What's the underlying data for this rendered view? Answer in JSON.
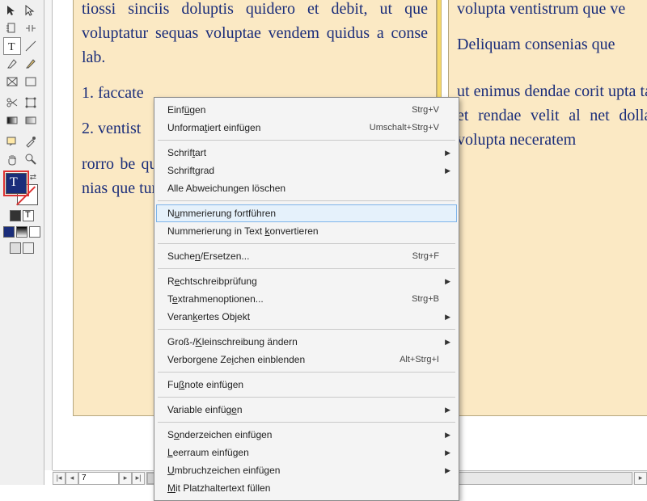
{
  "document": {
    "left_page": {
      "p1": "tiossi sinciis doluptis quidero et debit, ut que voluptatur sequas voluptae vendem quidus a conse lab.",
      "num1_no": "1.",
      "num1_text": "faccate",
      "num2_no": "2.",
      "num2_text": "ventist",
      "p2": "rorro be quam n les is m et lit, se everum ventistru nias que tum iun ea as ap"
    },
    "right_page": {
      "p1": "volupta ventistrum que ve",
      "p2": "Deliquam consenias que ",
      "p3": "ut enimus dendae corit upta tatium qui aliatio i orrum et rendae velit al net dollab is identio nec ndia volupta neceratem "
    }
  },
  "page_indicator": "7",
  "context_menu": {
    "items": [
      {
        "label": "Einfügen",
        "u": 4,
        "shortcut": "Strg+V"
      },
      {
        "label": "Unformatiert einfügen",
        "u": 7,
        "shortcut": "Umschalt+Strg+V"
      },
      {
        "sep": true
      },
      {
        "label": "Schriftart",
        "u": 6,
        "submenu": true
      },
      {
        "label": "Schriftgrad",
        "u": 7,
        "submenu": true
      },
      {
        "label": "Alle Abweichungen löschen"
      },
      {
        "sep": true
      },
      {
        "label": "Nummerierung fortführen",
        "u": 1,
        "hover": true
      },
      {
        "label": "Nummerierung in Text konvertieren",
        "u": 21
      },
      {
        "sep": true
      },
      {
        "label": "Suchen/Ersetzen...",
        "u": 5,
        "shortcut": "Strg+F"
      },
      {
        "sep": true
      },
      {
        "label": "Rechtschreibprüfung",
        "u": 1,
        "submenu": true
      },
      {
        "label": "Textrahmenoptionen...",
        "u": 1,
        "shortcut": "Strg+B"
      },
      {
        "label": "Verankertes Objekt",
        "u": 5,
        "submenu": true
      },
      {
        "sep": true
      },
      {
        "label": "Groß-/Kleinschreibung ändern",
        "u": 6,
        "submenu": true
      },
      {
        "label": "Verborgene Zeichen einblenden",
        "u": 13,
        "shortcut": "Alt+Strg+I"
      },
      {
        "sep": true
      },
      {
        "label": "Fußnote einfügen",
        "u": 2
      },
      {
        "sep": true
      },
      {
        "label": "Variable einfügen",
        "u": 15,
        "submenu": true
      },
      {
        "sep": true
      },
      {
        "label": "Sonderzeichen einfügen",
        "u": 1,
        "submenu": true
      },
      {
        "label": "Leerraum einfügen",
        "u": 0,
        "submenu": true
      },
      {
        "label": "Umbruchzeichen einfügen",
        "u": 0,
        "submenu": true
      },
      {
        "label": "Mit Platzhaltertext füllen",
        "u": 0
      }
    ]
  }
}
